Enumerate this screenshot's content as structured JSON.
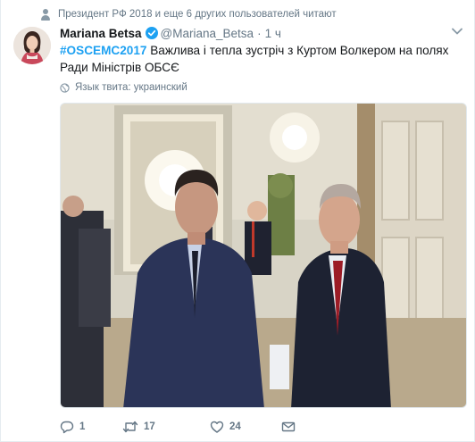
{
  "social_context": {
    "text": "Президент РФ 2018 и еще 6 других пользователей читают",
    "icon": "person-icon"
  },
  "tweet": {
    "fullname": "Mariana Betsa",
    "verified": true,
    "username": "@Mariana_Betsa",
    "separator": "·",
    "time": "1 ч",
    "hashtag": "#OSCEMC2017",
    "text": " Важлива і тепла зустріч з Куртом Волкером на полях Ради Міністрів ОБСЄ",
    "language": "Язык твита: украинский",
    "photo_icon": "photo-content"
  },
  "actions": {
    "reply_count": "1",
    "retweet_count": "17",
    "like_count": "24"
  },
  "colors": {
    "accent": "#1da1f2",
    "muted": "#657786",
    "text": "#14171a",
    "border": "#e6ecf0"
  }
}
